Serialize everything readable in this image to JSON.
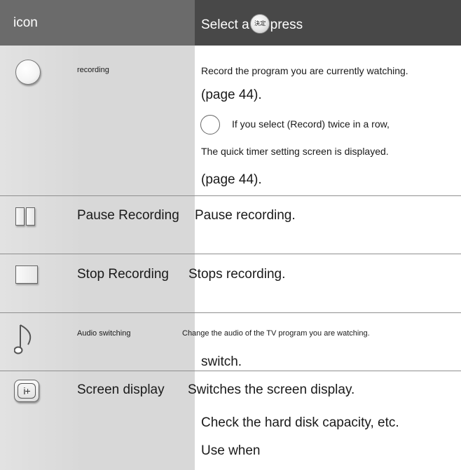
{
  "header": {
    "col1": "icon",
    "col2_before": "Select a",
    "col2_button_glyph": "決.定",
    "col2_after": "press"
  },
  "rows": [
    {
      "icon": "record-circle-icon",
      "name": "recording",
      "lines": [
        "Record the program you are currently watching.",
        "(page 44).",
        "If you select (Record) twice in a row,",
        "The quick timer setting screen is displayed.",
        "(page 44)."
      ]
    },
    {
      "icon": "pause-icon",
      "name": "Pause Recording",
      "lines": [
        "Pause recording."
      ]
    },
    {
      "icon": "stop-icon",
      "name": "Stop Recording",
      "lines": [
        "Stops recording."
      ]
    },
    {
      "icon": "music-note-icon",
      "name": "Audio switching",
      "lines": [
        "Change the audio of the TV program you are watching.",
        "switch."
      ]
    },
    {
      "icon": "screen-info-icon",
      "name": "Screen display",
      "lines": [
        "Switches the screen display.",
        "Check the hard disk capacity, etc.",
        "Use when"
      ]
    }
  ],
  "colors": {
    "header_left": "#6b6b6b",
    "header_right": "#484848",
    "left_column": "#d8d8d8",
    "separator": "#8f8f8f"
  }
}
